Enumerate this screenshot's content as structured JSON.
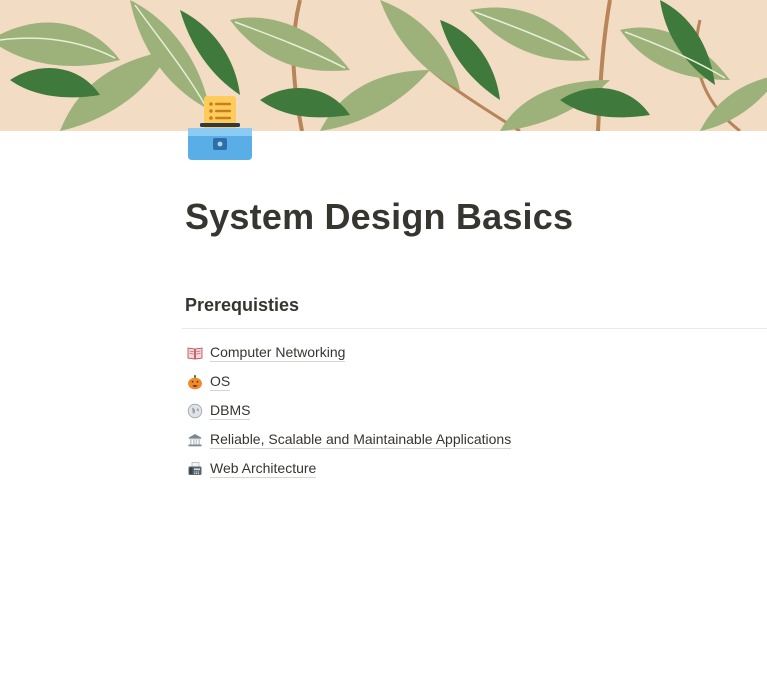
{
  "page": {
    "title": "System Design Basics",
    "icon": "card-file-box-icon"
  },
  "cover": {
    "pattern": "willow-leaves",
    "colors": {
      "background": "#f3dcc4",
      "leaf_light": "#9db27a",
      "leaf_dark": "#3f7a3c",
      "branch": "#b8855a"
    }
  },
  "prerequisites": {
    "heading": "Prerequisties",
    "items": [
      {
        "label": "Computer Networking",
        "icon": "open-book-icon"
      },
      {
        "label": "OS",
        "icon": "jack-o-lantern-icon"
      },
      {
        "label": "DBMS",
        "icon": "globe-icon"
      },
      {
        "label": "Reliable, Scalable and Maintainable Applications",
        "icon": "bank-icon"
      },
      {
        "label": "Web Architecture",
        "icon": "fax-machine-icon"
      }
    ]
  }
}
